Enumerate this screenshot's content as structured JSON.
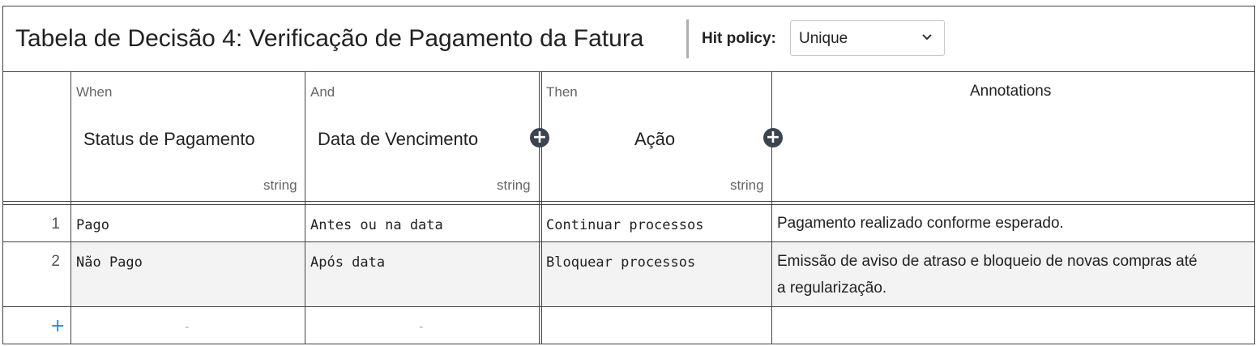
{
  "header": {
    "title": "Tabela de Decisão 4: Verificação de Pagamento da Fatura",
    "hit_policy_label": "Hit policy:",
    "hit_policy_value": "Unique"
  },
  "columns": [
    {
      "type": "When",
      "label": "Status de Pagamento",
      "dtype": "string"
    },
    {
      "type": "And",
      "label": "Data de Vencimento",
      "dtype": "string"
    },
    {
      "type": "Then",
      "label": "Ação",
      "dtype": "string"
    },
    {
      "label": "Annotations"
    }
  ],
  "rows": [
    {
      "num": "1",
      "cells": [
        "Pago",
        "Antes ou na data",
        "Continuar processos"
      ],
      "annotation": "Pagamento realizado conforme esperado."
    },
    {
      "num": "2",
      "cells": [
        "Não Pago",
        "Após data",
        "Bloquear processos"
      ],
      "annotation_line1": "Emissão de aviso de atraso e bloqueio de novas compras até",
      "annotation_line2": "a regularização."
    }
  ],
  "add_row": {
    "symbol": "+",
    "dash": "-"
  },
  "icons": {
    "add_column": "plus-circle-icon",
    "select_arrow": "chevron-down-icon"
  },
  "colors": {
    "add_row_accent": "#1e88e5",
    "add_column_button": "#3c4450"
  }
}
